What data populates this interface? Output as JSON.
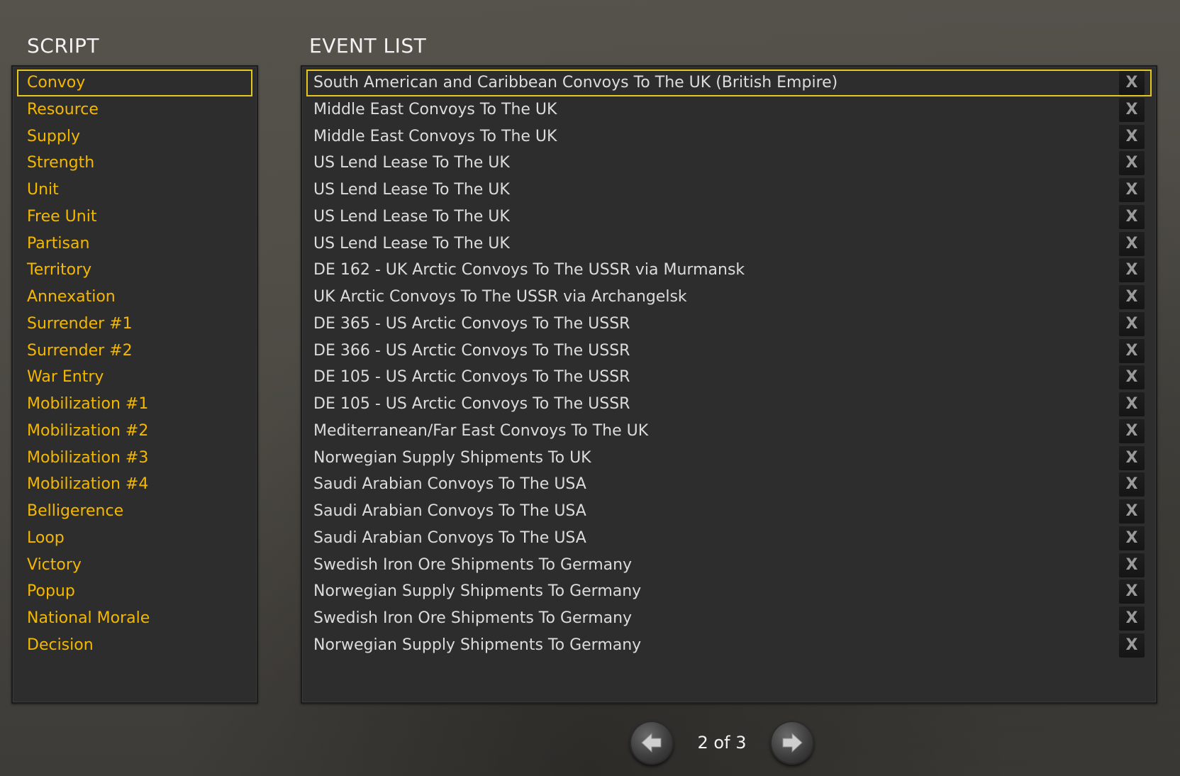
{
  "script_panel": {
    "title": "SCRIPT",
    "selected_index": 0,
    "items": [
      "Convoy",
      "Resource",
      "Supply",
      "Strength",
      "Unit",
      "Free Unit",
      "Partisan",
      "Territory",
      "Annexation",
      "Surrender #1",
      "Surrender #2",
      "War Entry",
      "Mobilization #1",
      "Mobilization #2",
      "Mobilization #3",
      "Mobilization #4",
      "Belligerence",
      "Loop",
      "Victory",
      "Popup",
      "National Morale",
      "Decision"
    ]
  },
  "event_panel": {
    "title": "EVENT LIST",
    "selected_index": 0,
    "delete_label": "X",
    "events": [
      "South American and Caribbean Convoys To The UK (British Empire)",
      "Middle East Convoys To The UK",
      "Middle East Convoys To The UK",
      "US Lend Lease To The UK",
      "US Lend Lease To The UK",
      "US Lend Lease To The UK",
      "US Lend Lease To The UK",
      "DE 162 - UK Arctic Convoys To The USSR via Murmansk",
      "UK Arctic Convoys To The USSR via Archangelsk",
      "DE 365 - US Arctic Convoys To The USSR",
      "DE 366 - US Arctic Convoys To The USSR",
      "DE 105 - US Arctic Convoys To The USSR",
      "DE 105 - US Arctic Convoys To The USSR",
      "Mediterranean/Far East Convoys To The UK",
      "Norwegian Supply Shipments To UK",
      "Saudi Arabian Convoys To The USA",
      "Saudi Arabian Convoys To The USA",
      "Saudi Arabian Convoys To The USA",
      "Swedish Iron Ore Shipments To Germany",
      "Norwegian Supply Shipments To Germany",
      "Swedish Iron Ore Shipments To Germany",
      "Norwegian Supply Shipments To Germany"
    ]
  },
  "pagination": {
    "label": "2 of 3",
    "prev_icon": "arrow-left-icon",
    "next_icon": "arrow-right-icon"
  },
  "colors": {
    "script_text": "#f5b800",
    "event_text": "#dcdcdc",
    "selection_border": "#e6c620",
    "panel_bg": "#2d2d2d"
  }
}
